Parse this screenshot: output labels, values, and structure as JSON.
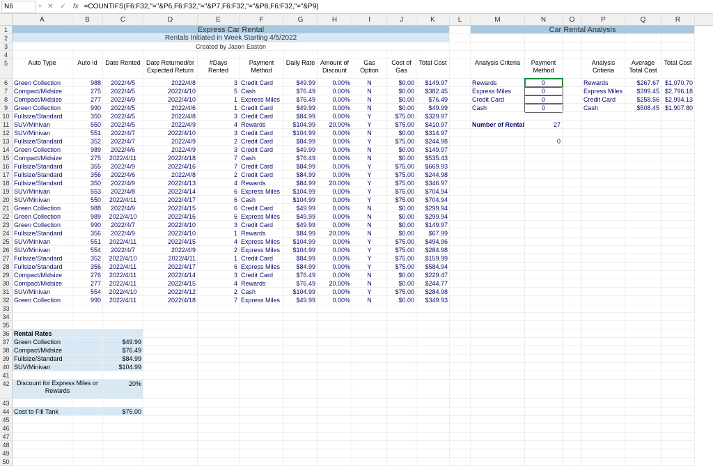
{
  "activeCell": "N6",
  "formula": "=COUNTIFS(F6:F32,\"=\"&P6,F6:F32,\"=\"&P7,F6:F32,\"=\"&P8,F6:F32,\"=\"&P9)",
  "columns": [
    "A",
    "B",
    "C",
    "D",
    "E",
    "F",
    "G",
    "H",
    "I",
    "J",
    "K",
    "L",
    "M",
    "N",
    "O",
    "P",
    "Q",
    "R"
  ],
  "title1": "Express Car Rental",
  "title2": "Rentals Initiated in Week Starting 4/5/2022",
  "title3": "Created by Jason Easton",
  "analysisTitle": "Car Rental Analysis",
  "headers": {
    "A": "Auto Type",
    "B": "Auto Id",
    "C": "Date Rented",
    "D": "Date Returned/or Expected Return",
    "E": "#Days Rented",
    "F": "Payment Method",
    "G": "Daily Rate",
    "H": "Amount of Discount",
    "I": "Gas Option",
    "J": "Cost of Gas",
    "K": "Total Cost"
  },
  "analysisHeaders": {
    "M": "Analysis Criteria",
    "N": "Payment Method",
    "P": "Analysis Critieria",
    "Q": "Average Total Cost",
    "R": "Total Cost"
  },
  "data": [
    {
      "r": 6,
      "A": "Green Collection",
      "B": "988",
      "C": "2022/4/5",
      "D": "2022/4/8",
      "E": "3",
      "F": "Credit Card",
      "G": "$49.99",
      "H": "0.00%",
      "I": "N",
      "J": "$0.00",
      "K": "$149.97"
    },
    {
      "r": 7,
      "A": "Compact/Midsize",
      "B": "275",
      "C": "2022/4/5",
      "D": "2022/4/10",
      "E": "5",
      "F": "Cash",
      "G": "$76.49",
      "H": "0.00%",
      "I": "N",
      "J": "$0.00",
      "K": "$382.45"
    },
    {
      "r": 8,
      "A": "Compact/Midsize",
      "B": "277",
      "C": "2022/4/9",
      "D": "2022/4/10",
      "E": "1",
      "F": "Express Miles",
      "G": "$76.49",
      "H": "0.00%",
      "I": "N",
      "J": "$0.00",
      "K": "$76.49"
    },
    {
      "r": 9,
      "A": "Green Collection",
      "B": "990",
      "C": "2022/4/5",
      "D": "2022/4/6",
      "E": "1",
      "F": "Credit Card",
      "G": "$49.99",
      "H": "0.00%",
      "I": "N",
      "J": "$0.00",
      "K": "$49.99"
    },
    {
      "r": 10,
      "A": "Fullsize/Standard",
      "B": "350",
      "C": "2022/4/5",
      "D": "2022/4/8",
      "E": "3",
      "F": "Credit Card",
      "G": "$84.99",
      "H": "0.00%",
      "I": "Y",
      "J": "$75.00",
      "K": "$329.97"
    },
    {
      "r": 11,
      "A": "SUV/Minivan",
      "B": "550",
      "C": "2022/4/5",
      "D": "2022/4/9",
      "E": "4",
      "F": "Rewards",
      "G": "$104.99",
      "H": "20.00%",
      "I": "Y",
      "J": "$75.00",
      "K": "$410.97"
    },
    {
      "r": 12,
      "A": "SUV/Minivan",
      "B": "551",
      "C": "2022/4/7",
      "D": "2022/4/10",
      "E": "3",
      "F": "Credit Card",
      "G": "$104.99",
      "H": "0.00%",
      "I": "N",
      "J": "$0.00",
      "K": "$314.97"
    },
    {
      "r": 13,
      "A": "Fullsize/Standard",
      "B": "352",
      "C": "2022/4/7",
      "D": "2022/4/9",
      "E": "2",
      "F": "Credit Card",
      "G": "$84.99",
      "H": "0.00%",
      "I": "Y",
      "J": "$75.00",
      "K": "$244.98"
    },
    {
      "r": 14,
      "A": "Green Collection",
      "B": "989",
      "C": "2022/4/6",
      "D": "2022/4/9",
      "E": "3",
      "F": "Credit Card",
      "G": "$49.99",
      "H": "0.00%",
      "I": "N",
      "J": "$0.00",
      "K": "$149.97"
    },
    {
      "r": 15,
      "A": "Compact/Midsize",
      "B": "275",
      "C": "2022/4/11",
      "D": "2022/4/18",
      "E": "7",
      "F": "Cash",
      "G": "$76.49",
      "H": "0.00%",
      "I": "N",
      "J": "$0.00",
      "K": "$535.43"
    },
    {
      "r": 16,
      "A": "Fullsize/Standard",
      "B": "355",
      "C": "2022/4/9",
      "D": "2022/4/16",
      "E": "7",
      "F": "Credit Card",
      "G": "$84.99",
      "H": "0.00%",
      "I": "Y",
      "J": "$75.00",
      "K": "$669.93"
    },
    {
      "r": 17,
      "A": "Fullsize/Standard",
      "B": "356",
      "C": "2022/4/6",
      "D": "2022/4/8",
      "E": "2",
      "F": "Credit Card",
      "G": "$84.99",
      "H": "0.00%",
      "I": "Y",
      "J": "$75.00",
      "K": "$244.98"
    },
    {
      "r": 18,
      "A": "Fullsize/Standard",
      "B": "350",
      "C": "2022/4/9",
      "D": "2022/4/13",
      "E": "4",
      "F": "Rewards",
      "G": "$84.99",
      "H": "20.00%",
      "I": "Y",
      "J": "$75.00",
      "K": "$346.97"
    },
    {
      "r": 19,
      "A": "SUV/Minivan",
      "B": "553",
      "C": "2022/4/8",
      "D": "2022/4/14",
      "E": "6",
      "F": "Express Miles",
      "G": "$104.99",
      "H": "0.00%",
      "I": "Y",
      "J": "$75.00",
      "K": "$704.94"
    },
    {
      "r": 20,
      "A": "SUV/Minivan",
      "B": "550",
      "C": "2022/4/11",
      "D": "2022/4/17",
      "E": "6",
      "F": "Cash",
      "G": "$104.99",
      "H": "0.00%",
      "I": "Y",
      "J": "$75.00",
      "K": "$704.94"
    },
    {
      "r": 21,
      "A": "Green Collection",
      "B": "988",
      "C": "2022/4/9",
      "D": "2022/4/15",
      "E": "6",
      "F": "Credit Card",
      "G": "$49.99",
      "H": "0.00%",
      "I": "N",
      "J": "$0.00",
      "K": "$299.94"
    },
    {
      "r": 22,
      "A": "Green Collection",
      "B": "989",
      "C": "2022/4/10",
      "D": "2022/4/16",
      "E": "6",
      "F": "Express Miles",
      "G": "$49.99",
      "H": "0.00%",
      "I": "N",
      "J": "$0.00",
      "K": "$299.94"
    },
    {
      "r": 23,
      "A": "Green Collection",
      "B": "990",
      "C": "2022/4/7",
      "D": "2022/4/10",
      "E": "3",
      "F": "Credit Card",
      "G": "$49.99",
      "H": "0.00%",
      "I": "N",
      "J": "$0.00",
      "K": "$149.97"
    },
    {
      "r": 24,
      "A": "Fullsize/Standard",
      "B": "356",
      "C": "2022/4/9",
      "D": "2022/4/10",
      "E": "1",
      "F": "Rewards",
      "G": "$84.99",
      "H": "20.00%",
      "I": "N",
      "J": "$0.00",
      "K": "$67.99"
    },
    {
      "r": 25,
      "A": "SUV/Minivan",
      "B": "551",
      "C": "2022/4/11",
      "D": "2022/4/15",
      "E": "4",
      "F": "Express Miles",
      "G": "$104.99",
      "H": "0.00%",
      "I": "Y",
      "J": "$75.00",
      "K": "$494.96"
    },
    {
      "r": 26,
      "A": "SUV/Minivan",
      "B": "554",
      "C": "2022/4/7",
      "D": "2022/4/9",
      "E": "2",
      "F": "Express Miles",
      "G": "$104.99",
      "H": "0.00%",
      "I": "Y",
      "J": "$75.00",
      "K": "$284.98"
    },
    {
      "r": 27,
      "A": "Fullsize/Standard",
      "B": "352",
      "C": "2022/4/10",
      "D": "2022/4/11",
      "E": "1",
      "F": "Credit Card",
      "G": "$84.99",
      "H": "0.00%",
      "I": "Y",
      "J": "$75.00",
      "K": "$159.99"
    },
    {
      "r": 28,
      "A": "Fullsize/Standard",
      "B": "356",
      "C": "2022/4/11",
      "D": "2022/4/17",
      "E": "6",
      "F": "Express Miles",
      "G": "$84.99",
      "H": "0.00%",
      "I": "Y",
      "J": "$75.00",
      "K": "$584.94"
    },
    {
      "r": 29,
      "A": "Compact/Midsize",
      "B": "276",
      "C": "2022/4/11",
      "D": "2022/4/14",
      "E": "3",
      "F": "Credit Card",
      "G": "$76.49",
      "H": "0.00%",
      "I": "N",
      "J": "$0.00",
      "K": "$229.47"
    },
    {
      "r": 30,
      "A": "Compact/Midsize",
      "B": "277",
      "C": "2022/4/11",
      "D": "2022/4/15",
      "E": "4",
      "F": "Rewards",
      "G": "$76.49",
      "H": "20.00%",
      "I": "N",
      "J": "$0.00",
      "K": "$244.77"
    },
    {
      "r": 31,
      "A": "SUV/Minivan",
      "B": "554",
      "C": "2022/4/10",
      "D": "2022/4/12",
      "E": "2",
      "F": "Cash",
      "G": "$104.99",
      "H": "0.00%",
      "I": "Y",
      "J": "$75.00",
      "K": "$284.98"
    },
    {
      "r": 32,
      "A": "Green Collection",
      "B": "990",
      "C": "2022/4/11",
      "D": "2022/4/18",
      "E": "7",
      "F": "Express Miles",
      "G": "$49.99",
      "H": "0.00%",
      "I": "N",
      "J": "$0.00",
      "K": "$349.93"
    }
  ],
  "analysisLeft": [
    {
      "r": 6,
      "M": "Rewards",
      "N": "0"
    },
    {
      "r": 7,
      "M": "Express Miles",
      "N": "0"
    },
    {
      "r": 8,
      "M": "Credit Card",
      "N": "0"
    },
    {
      "r": 9,
      "M": "Cash",
      "N": "0"
    },
    {
      "r": 11,
      "M": "Number of Rentals",
      "N": "27"
    },
    {
      "r": 13,
      "M": "",
      "N": "0"
    }
  ],
  "analysisRight": [
    {
      "r": 6,
      "P": "Rewards",
      "Q": "$267.67",
      "R": "$1,070.70"
    },
    {
      "r": 7,
      "P": "Express Miles",
      "Q": "$399.45",
      "R": "$2,796.18"
    },
    {
      "r": 8,
      "P": "Credit Card",
      "Q": "$258.56",
      "R": "$2,994.13"
    },
    {
      "r": 9,
      "P": "Cash",
      "Q": "$508.45",
      "R": "$1,907.80"
    }
  ],
  "rentalRates": {
    "title": "Rental Rates",
    "rows": [
      {
        "label": "Green Collection",
        "val": "$49.99"
      },
      {
        "label": "Compact/Midsize",
        "val": "$76.49"
      },
      {
        "label": "Fullsize/Standard",
        "val": "$84.99"
      },
      {
        "label": "SUV/Minivan",
        "val": "$104.99"
      }
    ]
  },
  "discountLabel": "Discount for Express Miles or Rewards",
  "discountVal": "20%",
  "fillTankLabel": "Cost to Fill Tank",
  "fillTankVal": "$75.00"
}
